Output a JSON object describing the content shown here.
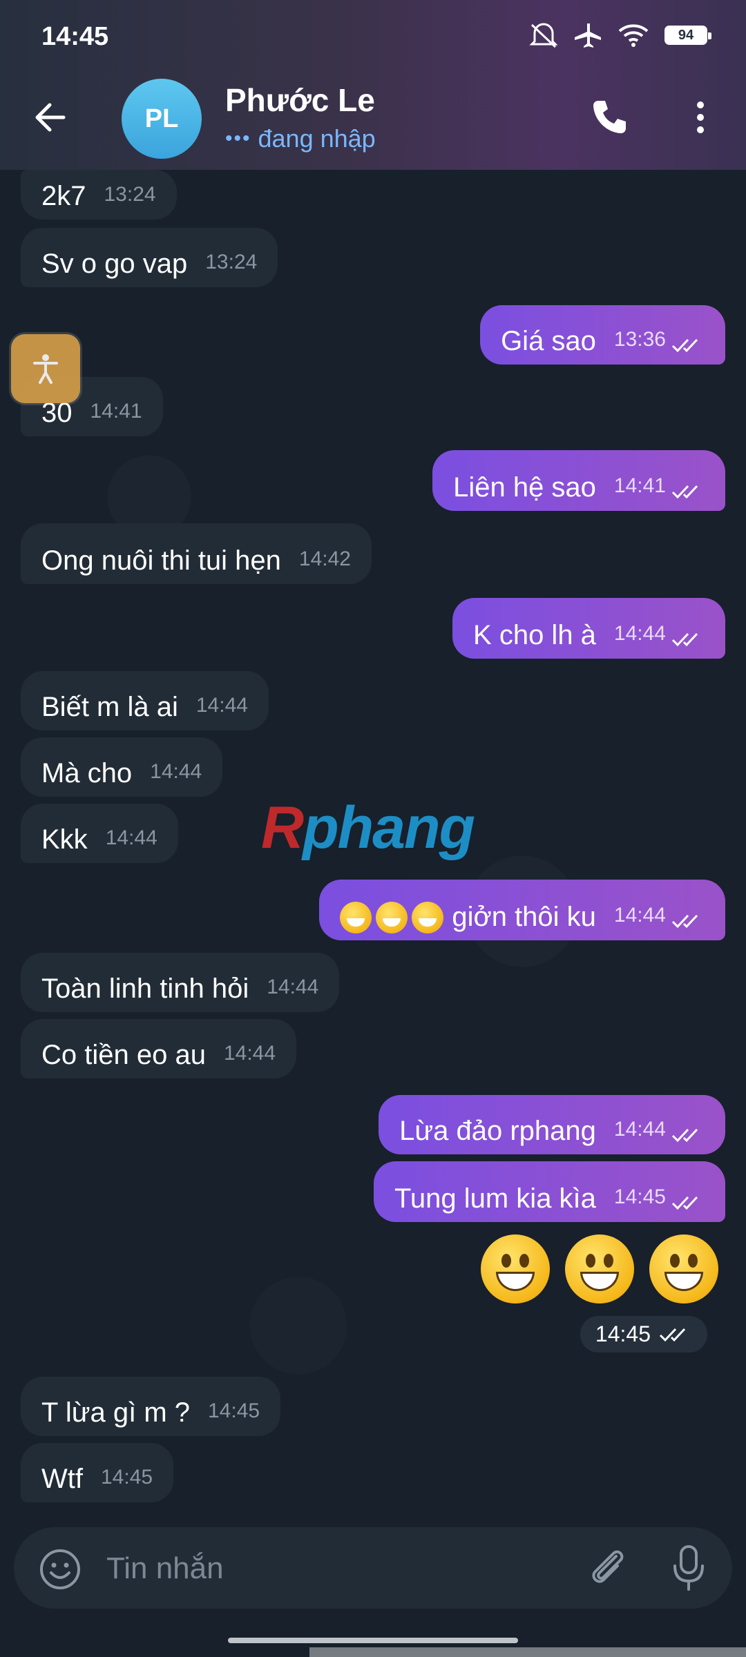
{
  "status_bar": {
    "time": "14:45",
    "battery": "94"
  },
  "header": {
    "avatar_initials": "PL",
    "contact_name": "Phước Le",
    "contact_status": "đang nhập"
  },
  "messages": [
    {
      "text": "2k7",
      "time": "13:24",
      "dir": "in"
    },
    {
      "text": "Sv o go vap",
      "time": "13:24",
      "dir": "in"
    },
    {
      "text": "Giá sao",
      "time": "13:36",
      "dir": "out"
    },
    {
      "text": "30",
      "time": "14:41",
      "dir": "in"
    },
    {
      "text": "Liên hệ sao",
      "time": "14:41",
      "dir": "out"
    },
    {
      "text": "Ong nuôi thi tui hẹn",
      "time": "14:42",
      "dir": "in"
    },
    {
      "text": "K cho lh à",
      "time": "14:44",
      "dir": "out"
    },
    {
      "text": "Biết m là ai",
      "time": "14:44",
      "dir": "in"
    },
    {
      "text": "Mà cho",
      "time": "14:44",
      "dir": "in"
    },
    {
      "text": "Kkk",
      "time": "14:44",
      "dir": "in"
    },
    {
      "text": "giởn thôi ku",
      "time": "14:44",
      "dir": "out"
    },
    {
      "text": "Toàn linh tinh hỏi",
      "time": "14:44",
      "dir": "in"
    },
    {
      "text": "Co tiền eo au",
      "time": "14:44",
      "dir": "in"
    },
    {
      "text": "Lừa đảo rphang",
      "time": "14:44",
      "dir": "out"
    },
    {
      "text": "Tung lum kia kìa",
      "time": "14:45",
      "dir": "out"
    },
    {
      "text": "",
      "time": "14:45",
      "dir": "out"
    },
    {
      "text": "T lừa gì m ?",
      "time": "14:45",
      "dir": "in"
    },
    {
      "text": "Wtf",
      "time": "14:45",
      "dir": "in"
    }
  ],
  "watermark": {
    "r": "R",
    "rest": "phang"
  },
  "composer": {
    "placeholder": "Tin nhắn"
  },
  "icons": {
    "back": "arrow-left-icon",
    "call": "phone-icon",
    "menu": "more-vertical-icon",
    "emoji": "smile-icon",
    "attach": "paperclip-icon",
    "mic": "microphone-icon",
    "accessibility": "accessibility-icon"
  }
}
